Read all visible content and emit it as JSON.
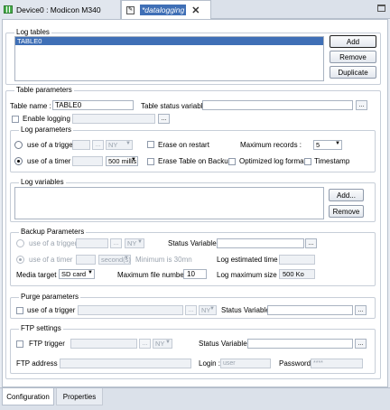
{
  "tabs": [
    {
      "label": "Device0 : Modicon M340"
    },
    {
      "label": "*datalogging"
    }
  ],
  "log_tables": {
    "title": "Log tables",
    "items": [
      "TABLE0"
    ],
    "add": "Add",
    "remove": "Remove",
    "duplicate": "Duplicate"
  },
  "table_parameters": {
    "title": "Table parameters",
    "name_label": "Table name :",
    "name_value": "TABLE0",
    "status_var_label": "Table status variable",
    "status_var_value": "",
    "enable_logging": "Enable logging",
    "browse": "..."
  },
  "log_parameters": {
    "title": "Log parameters",
    "trigger": "use of a trigger",
    "trigger_unit": "NY",
    "erase_on_restart": "Erase on restart",
    "max_records_label": "Maximum records :",
    "max_records_value": "5",
    "timer": "use of a timer",
    "timer_unit": "500 millis",
    "erase_table_backup": "Erase Table on Backup",
    "optimized": "Optimized log format",
    "timestamp": "Timestamp"
  },
  "log_variables": {
    "title": "Log variables",
    "add": "Add...",
    "remove": "Remove"
  },
  "backup": {
    "title": "Backup Parameters",
    "trigger": "use of a trigger",
    "trigger_unit": "NY",
    "status_var": "Status Variable",
    "timer": "use of a timer",
    "timer_unit": "second(s)",
    "minimum": "Minimum is 30mn",
    "estimated": "Log estimated time :",
    "media_label": "Media target :",
    "media_value": "SD card",
    "max_file_label": "Maximum file number :",
    "max_file_value": "10",
    "max_size_label": "Log maximum size :",
    "max_size_value": "500 Ko"
  },
  "purge": {
    "title": "Purge parameters",
    "trigger": "use of a trigger",
    "trigger_unit": "NY",
    "status_var": "Status Variable"
  },
  "ftp": {
    "title": "FTP settings",
    "trigger": "FTP trigger",
    "trigger_unit": "NY",
    "status_var": "Status Variable",
    "address": "FTP address :",
    "login": "Login :",
    "login_ph": "user",
    "password": "Password :",
    "password_ph": "****"
  },
  "bottom_tabs": [
    {
      "label": "Configuration"
    },
    {
      "label": "Properties"
    }
  ]
}
